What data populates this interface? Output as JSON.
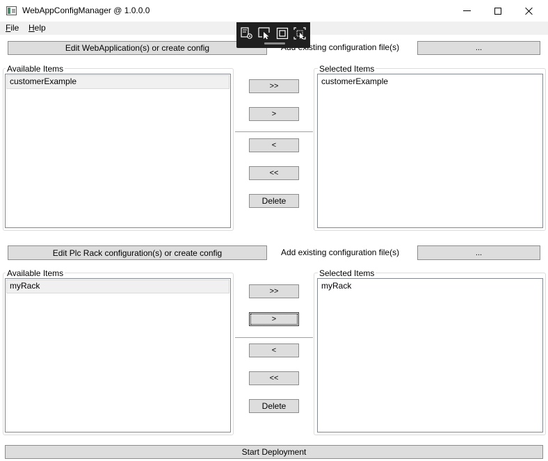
{
  "window": {
    "title": "WebAppConfigManager @ 1.0.0.0"
  },
  "menu": {
    "file": "File",
    "help": "Help"
  },
  "webapp_section": {
    "edit_button": "Edit WebApplication(s) or create config",
    "add_label": "Add existing configuration file(s)",
    "browse_button": "...",
    "available_title": "Available Items",
    "available_items": [
      "customerExample"
    ],
    "selected_title": "Selected Items",
    "selected_items": [
      "customerExample"
    ],
    "buttons": {
      "add_all": ">>",
      "add": ">",
      "remove": "<",
      "remove_all": "<<",
      "delete": "Delete"
    }
  },
  "plc_section": {
    "edit_button": "Edit Plc Rack configuration(s) or create config",
    "add_label": "Add existing configuration file(s)",
    "browse_button": "...",
    "available_title": "Available Items",
    "available_items": [
      "myRack"
    ],
    "selected_title": "Selected Items",
    "selected_items": [
      "myRack"
    ],
    "buttons": {
      "add_all": ">>",
      "add": ">",
      "remove": "<",
      "remove_all": "<<",
      "delete": "Delete"
    }
  },
  "footer": {
    "start_button": "Start Deployment"
  },
  "overlay_toolbar": {
    "icons": [
      "live-visual-tree-icon",
      "select-element-icon",
      "display-layout-adorners-icon",
      "track-focus-icon"
    ]
  }
}
